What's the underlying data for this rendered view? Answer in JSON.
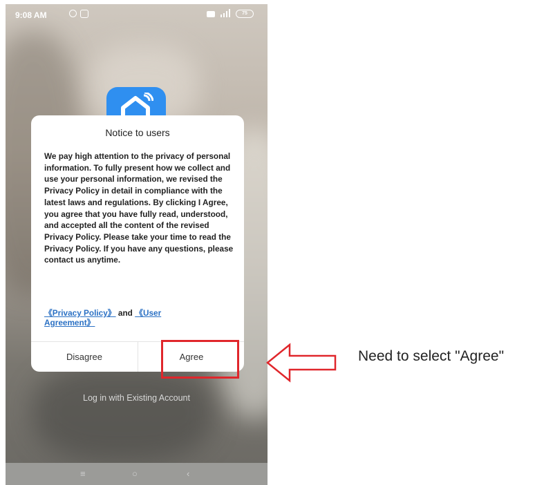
{
  "status_bar": {
    "time": "9:08 AM",
    "battery": "75"
  },
  "dialog": {
    "title": "Notice to users",
    "body": "We pay high attention to the privacy of personal information. To fully present how we collect and use your personal information, we revised the Privacy Policy in detail in compliance with the latest laws and regulations. By clicking I Agree, you agree that you have fully read, understood, and accepted all the content of the revised Privacy Policy. Please take your time to read the Privacy Policy. If you have any questions, please contact us anytime.",
    "privacy_link": "《Privacy Policy》",
    "and_text": "and",
    "agreement_link": "《User Agreement》",
    "disagree_label": "Disagree",
    "agree_label": "Agree"
  },
  "login_link": "Log in with Existing Account",
  "navigation": {
    "menu": "≡",
    "home": "○",
    "back": "‹"
  },
  "annotation": {
    "instruction": "Need to select \"Agree\"",
    "color": "#e0262b"
  },
  "colors": {
    "app_blue": "#2f8ff0",
    "link_blue": "#2b71c4"
  },
  "icons": [
    "alarm-icon",
    "app-notification-icon",
    "message-icon",
    "signal-icon",
    "battery-icon",
    "app-logo-icon",
    "arrow-left-icon"
  ]
}
